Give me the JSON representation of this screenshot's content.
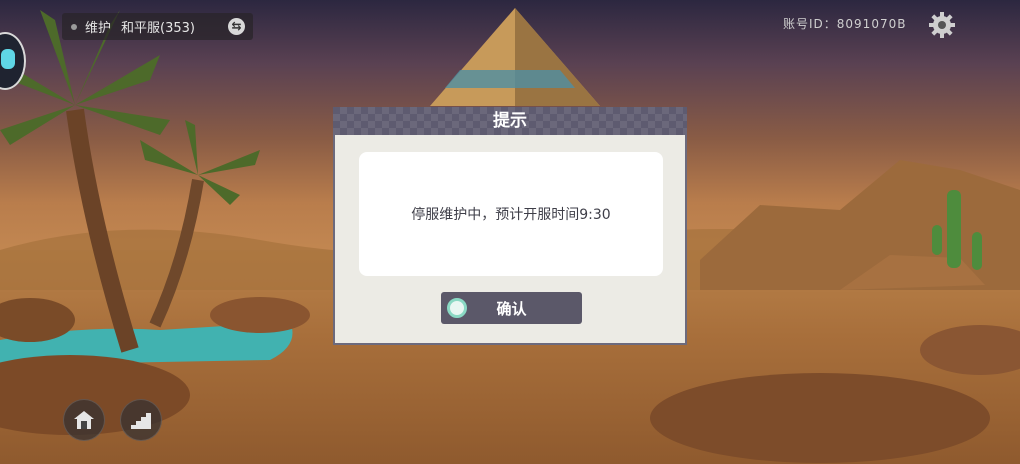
{
  "server": {
    "status": "维护",
    "name": "和平服(353)"
  },
  "account": {
    "label": "账号ID：8091070B"
  },
  "dialog": {
    "title": "提示",
    "message": "停服维护中，预计开服时间9:30",
    "confirm_label": "确认"
  },
  "icons": {
    "settings": "gear-icon",
    "swap": "swap-server-icon",
    "home": "home-icon",
    "stairs": "stairs-icon",
    "confirm": "circle-icon"
  },
  "colors": {
    "dialog_header": "#5e5b70",
    "dialog_bg": "#ecebe5",
    "confirm_button": "#5b5869",
    "confirm_ring": "#8ad9c4"
  }
}
